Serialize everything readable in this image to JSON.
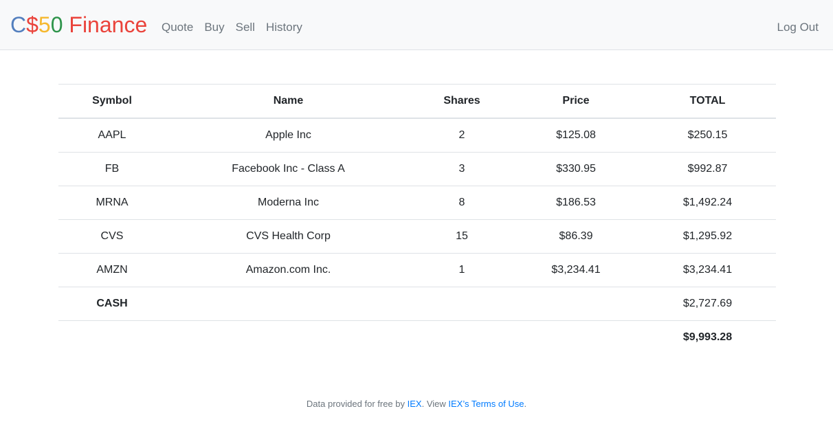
{
  "brand": {
    "parts": [
      {
        "text": "C",
        "color": "#537fbe"
      },
      {
        "text": "$",
        "color": "#ea433b"
      },
      {
        "text": "5",
        "color": "#f5b82e"
      },
      {
        "text": "0",
        "color": "#2e944b"
      },
      {
        "text": " Finance",
        "color": "#ea433b"
      }
    ]
  },
  "nav": {
    "links": [
      "Quote",
      "Buy",
      "Sell",
      "History"
    ],
    "logout": "Log Out"
  },
  "table": {
    "headers": [
      "Symbol",
      "Name",
      "Shares",
      "Price",
      "TOTAL"
    ],
    "rows": [
      {
        "symbol": "AAPL",
        "name": "Apple Inc",
        "shares": "2",
        "price": "$125.08",
        "total": "$250.15"
      },
      {
        "symbol": "FB",
        "name": "Facebook Inc - Class A",
        "shares": "3",
        "price": "$330.95",
        "total": "$992.87"
      },
      {
        "symbol": "MRNA",
        "name": "Moderna Inc",
        "shares": "8",
        "price": "$186.53",
        "total": "$1,492.24"
      },
      {
        "symbol": "CVS",
        "name": "CVS Health Corp",
        "shares": "15",
        "price": "$86.39",
        "total": "$1,295.92"
      },
      {
        "symbol": "AMZN",
        "name": "Amazon.com Inc.",
        "shares": "1",
        "price": "$3,234.41",
        "total": "$3,234.41"
      }
    ],
    "cash": {
      "label": "CASH",
      "total": "$2,727.69"
    },
    "grand_total": "$9,993.28"
  },
  "footer": {
    "prefix": "Data provided for free by ",
    "iex_link": "IEX",
    "middle": ". View ",
    "terms_link": "IEX’s Terms of Use",
    "suffix": "."
  }
}
